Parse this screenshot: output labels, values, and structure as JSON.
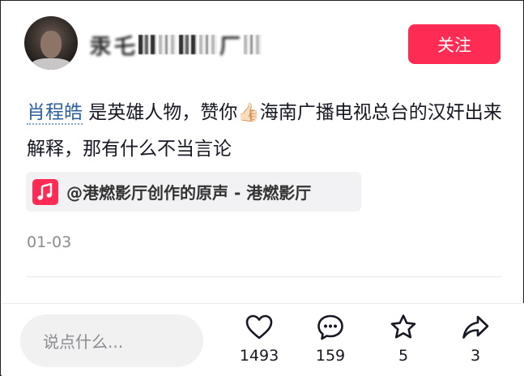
{
  "user": {
    "name_visible_chars": [
      "汞",
      "乇",
      "冒",
      "鄙",
      "仨",
      "丐",
      "厂"
    ],
    "follow_label": "关注"
  },
  "comment": {
    "mention": "肖程皓",
    "text_part1": " 是英雄人物，赞你",
    "emoji": "👍🏻",
    "text_part2": "海南广播电视总台的汉奸出来解释，那有什么不当言论"
  },
  "music": {
    "label": "@港燃影厅创作的原声 - 港燃影厅",
    "icon": "music-note-icon",
    "accent": "#fe2c55"
  },
  "date": "01-03",
  "input": {
    "placeholder": "说点什么..."
  },
  "actions": [
    {
      "icon": "heart-icon",
      "count": "1493"
    },
    {
      "icon": "comment-bubble-icon",
      "count": "159"
    },
    {
      "icon": "star-icon",
      "count": "5"
    },
    {
      "icon": "share-arrow-icon",
      "count": "3"
    }
  ],
  "colors": {
    "accent": "#fe2c55",
    "mention": "#2b5f9e",
    "muted": "#8a8b91"
  }
}
